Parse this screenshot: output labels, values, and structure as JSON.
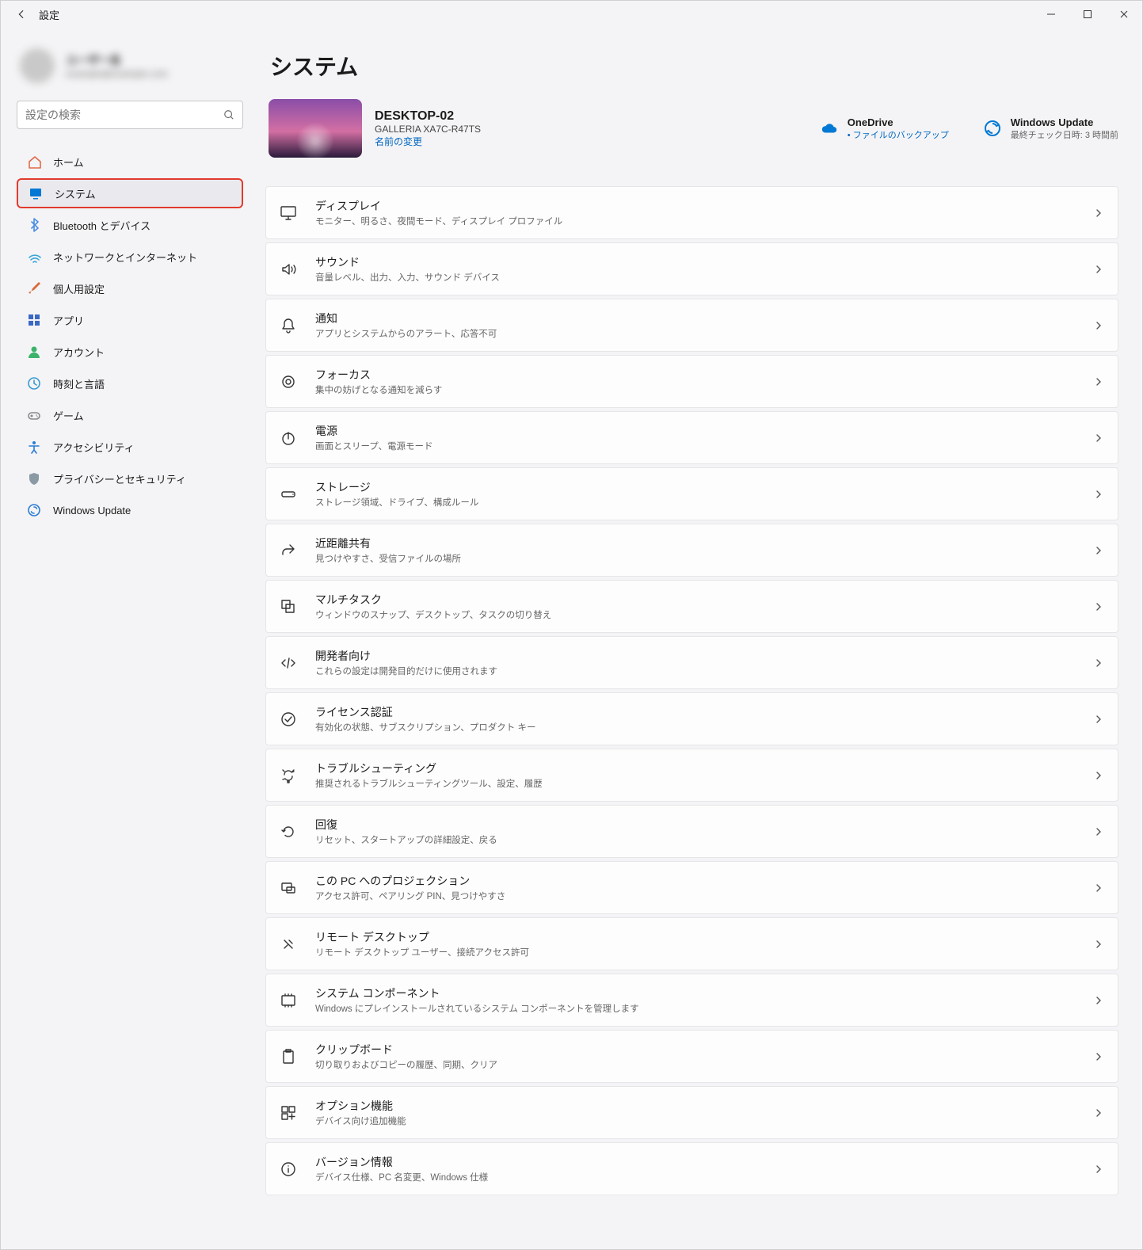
{
  "window_title": "設定",
  "account": {
    "name": "ユーザー名",
    "mail": "example@example.com"
  },
  "search_placeholder": "設定の検索",
  "nav": [
    {
      "icon": "home",
      "color": "#e06a4a",
      "label": "ホーム"
    },
    {
      "icon": "system",
      "color": "#0078d4",
      "label": "システム",
      "active": true,
      "highlight": true
    },
    {
      "icon": "bluetooth",
      "color": "#4a8de0",
      "label": "Bluetooth とデバイス"
    },
    {
      "icon": "network",
      "color": "#3aa7d8",
      "label": "ネットワークとインターネット"
    },
    {
      "icon": "brush",
      "color": "#d86b3a",
      "label": "個人用設定"
    },
    {
      "icon": "apps",
      "color": "#3a68c4",
      "label": "アプリ"
    },
    {
      "icon": "account",
      "color": "#3cb36b",
      "label": "アカウント"
    },
    {
      "icon": "time",
      "color": "#3a9ad0",
      "label": "時刻と言語"
    },
    {
      "icon": "gaming",
      "color": "#888",
      "label": "ゲーム"
    },
    {
      "icon": "access",
      "color": "#2b7cd3",
      "label": "アクセシビリティ"
    },
    {
      "icon": "privacy",
      "color": "#8a9aa5",
      "label": "プライバシーとセキュリティ"
    },
    {
      "icon": "update",
      "color": "#2b7cd3",
      "label": "Windows Update"
    }
  ],
  "page_title": "システム",
  "device": {
    "name": "DESKTOP-02",
    "model": "GALLERIA XA7C-R47TS",
    "rename": "名前の変更"
  },
  "onedrive": {
    "title": "OneDrive",
    "sub": "ファイルのバックアップ"
  },
  "winupdate": {
    "title": "Windows Update",
    "sub": "最終チェック日時: 3 時間前"
  },
  "cards": [
    {
      "icon": "display",
      "title": "ディスプレイ",
      "desc": "モニター、明るさ、夜間モード、ディスプレイ プロファイル"
    },
    {
      "icon": "sound",
      "title": "サウンド",
      "desc": "音量レベル、出力、入力、サウンド デバイス"
    },
    {
      "icon": "notify",
      "title": "通知",
      "desc": "アプリとシステムからのアラート、応答不可"
    },
    {
      "icon": "focus",
      "title": "フォーカス",
      "desc": "集中の妨げとなる通知を減らす"
    },
    {
      "icon": "power",
      "title": "電源",
      "desc": "画面とスリープ、電源モード"
    },
    {
      "icon": "storage",
      "title": "ストレージ",
      "desc": "ストレージ領域、ドライブ、構成ルール"
    },
    {
      "icon": "share",
      "title": "近距離共有",
      "desc": "見つけやすさ、受信ファイルの場所"
    },
    {
      "icon": "multitask",
      "title": "マルチタスク",
      "desc": "ウィンドウのスナップ、デスクトップ、タスクの切り替え"
    },
    {
      "icon": "dev",
      "title": "開発者向け",
      "desc": "これらの設定は開発目的だけに使用されます"
    },
    {
      "icon": "license",
      "title": "ライセンス認証",
      "desc": "有効化の状態、サブスクリプション、プロダクト キー"
    },
    {
      "icon": "trouble",
      "title": "トラブルシューティング",
      "desc": "推奨されるトラブルシューティングツール、設定、履歴"
    },
    {
      "icon": "recovery",
      "title": "回復",
      "desc": "リセット、スタートアップの詳細設定、戻る"
    },
    {
      "icon": "project",
      "title": "この PC へのプロジェクション",
      "desc": "アクセス許可、ペアリング PIN、見つけやすさ"
    },
    {
      "icon": "remote",
      "title": "リモート デスクトップ",
      "desc": "リモート デスクトップ ユーザー、接続アクセス許可"
    },
    {
      "icon": "components",
      "title": "システム コンポーネント",
      "desc": "Windows にプレインストールされているシステム コンポーネントを管理します"
    },
    {
      "icon": "clipboard",
      "title": "クリップボード",
      "desc": "切り取りおよびコピーの履歴、同期、クリア"
    },
    {
      "icon": "optional",
      "title": "オプション機能",
      "desc": "デバイス向け追加機能"
    },
    {
      "icon": "about",
      "title": "バージョン情報",
      "desc": "デバイス仕様、PC 名変更、Windows 仕様"
    }
  ]
}
